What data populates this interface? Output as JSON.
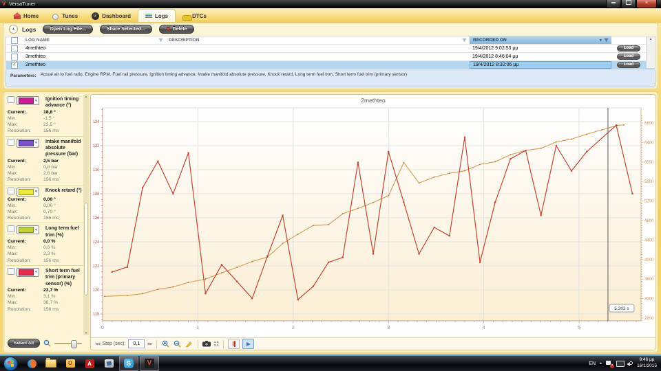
{
  "window": {
    "title": "VersaTuner"
  },
  "tabs": [
    {
      "label": "Home"
    },
    {
      "label": "Tunes"
    },
    {
      "label": "Dashboard"
    },
    {
      "label": "Logs"
    },
    {
      "label": "DTCs"
    }
  ],
  "logs_section": {
    "header": "Logs",
    "open_button": "Open Log File...",
    "share_button": "Share Selected...",
    "delete_button": "Delete"
  },
  "log_table": {
    "columns": {
      "name": "LOG NAME",
      "description": "DESCRIPTION",
      "recorded": "RECORDED ON"
    },
    "rows": [
      {
        "name": "4methteo",
        "description": "",
        "recorded": "19/4/2012 9:02:53 μμ",
        "load_label": "Load"
      },
      {
        "name": "3methteo",
        "description": "",
        "recorded": "19/4/2012 8:46:04 μμ",
        "load_label": "Load"
      },
      {
        "name": "2methteo",
        "description": "",
        "recorded": "19/4/2012 8:32:06 μμ",
        "load_label": "Load",
        "selected": true
      }
    ]
  },
  "parameters": {
    "label": "Parameters:",
    "text": "Actual air to fuel ratio, Engine RPM, Fuel rail pressure, Ignition timing advance, Intake manifold absolute pressure, Knock retard, Long term fuel trim, Short term fuel trim (primary sensor)"
  },
  "sidebar": {
    "row_labels": {
      "current": "Current:",
      "min": "Min:",
      "max": "Max:",
      "resolution": "Resolution:"
    },
    "select_all_label": "Select All",
    "panels": [
      {
        "title": "Ignition timing advance (°)",
        "color": "#cc1d96",
        "current": "18,8 °",
        "min": "-1,5 °",
        "max": "22,5 °",
        "resolution": "156 ms"
      },
      {
        "title": "Intake manifold absolute pressure (bar)",
        "color": "#7a4fd0",
        "current": "2,5 bar",
        "min": "0,8 bar",
        "max": "2,6 bar",
        "resolution": "156 ms"
      },
      {
        "title": "Knock retard (°)",
        "color": "#efe93a",
        "current": "0,00 °",
        "min": "0,00 °",
        "max": "0,70 °",
        "resolution": "156 ms"
      },
      {
        "title": "Long term fuel trim (%)",
        "color": "#bfd135",
        "current": "0,0 %",
        "min": "0,0 %",
        "max": "2,3 %",
        "resolution": "156 ms"
      },
      {
        "title": "Short term fuel trim (primary sensor) (%)",
        "color": "#e32a4b",
        "current": "22,7 %",
        "min": "3,1 %",
        "max": "36,7 %",
        "resolution": "156 ms"
      }
    ]
  },
  "chart": {
    "toolbar": {
      "step_label": "Step (sec):",
      "step_value": "0,1"
    }
  },
  "chart_data": {
    "type": "line",
    "title": "2methteo",
    "xlabel": "",
    "ylabel_left": "",
    "x_unit": "sec",
    "x_max": 5.65,
    "x_ticks": [
      0,
      1,
      2,
      3,
      4,
      5
    ],
    "grid": true,
    "left_axis": {
      "min": 118,
      "max": 134,
      "step": 2,
      "tick_color": "#c3574b"
    },
    "right_axis": {
      "min": 2800,
      "max": 6800,
      "step": 400,
      "tick_color": "#cf8f4e"
    },
    "cursor": {
      "x": 5.303,
      "label": "5,303 s"
    },
    "series": [
      {
        "name": "orange-series",
        "axis": "right",
        "color": "#d9a05c",
        "marker": "dot",
        "points": [
          [
            0.02,
            3245
          ],
          [
            0.26,
            3265
          ],
          [
            0.42,
            3300
          ],
          [
            0.58,
            3390
          ],
          [
            0.74,
            3440
          ],
          [
            0.9,
            3530
          ],
          [
            1.08,
            3600
          ],
          [
            1.25,
            3730
          ],
          [
            1.41,
            3840
          ],
          [
            1.57,
            3960
          ],
          [
            1.73,
            4050
          ],
          [
            1.89,
            4330
          ],
          [
            2.05,
            4520
          ],
          [
            2.21,
            4700
          ],
          [
            2.37,
            4715
          ],
          [
            2.52,
            4940
          ],
          [
            2.68,
            5050
          ],
          [
            2.84,
            5170
          ],
          [
            3.0,
            5310
          ],
          [
            3.16,
            5990
          ],
          [
            3.32,
            5570
          ],
          [
            3.48,
            5690
          ],
          [
            3.64,
            5770
          ],
          [
            3.8,
            5820
          ],
          [
            3.96,
            5950
          ],
          [
            4.12,
            6005
          ],
          [
            4.28,
            6150
          ],
          [
            4.44,
            6240
          ],
          [
            4.6,
            6280
          ],
          [
            4.76,
            6410
          ],
          [
            4.92,
            6470
          ],
          [
            5.08,
            6570
          ],
          [
            5.24,
            6660
          ],
          [
            5.4,
            6750
          ],
          [
            5.47,
            6760
          ]
        ]
      },
      {
        "name": "red-series",
        "axis": "left",
        "color": "#c2452f",
        "marker": "square",
        "points": [
          [
            0.1,
            121.5
          ],
          [
            0.26,
            121.9
          ],
          [
            0.42,
            128.5
          ],
          [
            0.58,
            130.7
          ],
          [
            0.74,
            128.0
          ],
          [
            0.9,
            131.4
          ],
          [
            1.08,
            119.7
          ],
          [
            1.25,
            122.1
          ],
          [
            1.41,
            120.7
          ],
          [
            1.57,
            119.3
          ],
          [
            1.73,
            122.8
          ],
          [
            1.89,
            126.2
          ],
          [
            2.05,
            119.2
          ],
          [
            2.21,
            120.3
          ],
          [
            2.37,
            122.3
          ],
          [
            2.52,
            122.7
          ],
          [
            2.68,
            130.6
          ],
          [
            2.84,
            123.0
          ],
          [
            3.0,
            131.5
          ],
          [
            3.16,
            127.3
          ],
          [
            3.32,
            123.0
          ],
          [
            3.48,
            125.2
          ],
          [
            3.64,
            124.5
          ],
          [
            3.8,
            132.7
          ],
          [
            3.96,
            122.3
          ],
          [
            4.12,
            127.3
          ],
          [
            4.28,
            130.9
          ],
          [
            4.44,
            131.6
          ],
          [
            4.6,
            126.2
          ],
          [
            4.76,
            132.0
          ],
          [
            4.92,
            129.9
          ],
          [
            5.08,
            131.5
          ],
          [
            5.39,
            133.7
          ],
          [
            5.56,
            128.0
          ]
        ]
      }
    ]
  },
  "taskbar": {
    "tray": {
      "lang": "EN",
      "time": "9:46 μμ",
      "date": "16/1/2015"
    }
  }
}
